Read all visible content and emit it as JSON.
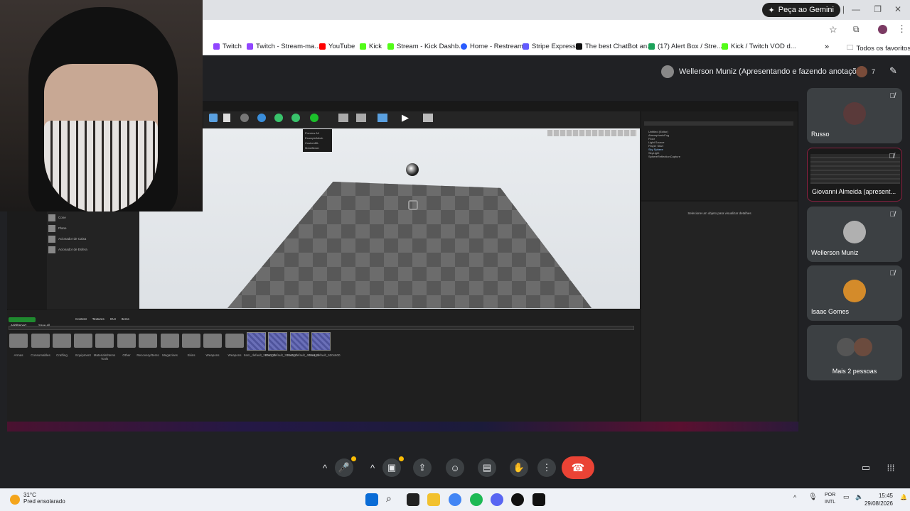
{
  "browser": {
    "gemini_label": "Peça ao Gemini",
    "bookmarks": [
      {
        "label": "Twitch",
        "color": "#9146ff"
      },
      {
        "label": "Twitch - Stream-ma...",
        "color": "#9146ff"
      },
      {
        "label": "YouTube",
        "color": "#ff0000"
      },
      {
        "label": "Kick",
        "color": "#53fc18"
      },
      {
        "label": "Stream - Kick Dashb...",
        "color": "#53fc18"
      },
      {
        "label": "Home - Restream",
        "color": "#2a5cff"
      },
      {
        "label": "Stripe Express",
        "color": "#635bff"
      },
      {
        "label": "The best ChatBot an...",
        "color": "#111111"
      },
      {
        "label": "(17) Alert Box / Stre...",
        "color": "#1ca25a"
      },
      {
        "label": "Kick / Twitch VOD d...",
        "color": "#53fc18"
      }
    ],
    "all_favorites": "Todos os favoritos"
  },
  "meet": {
    "presenter_label": "Wellerson Muniz (Apresentando e fazendo anotações)",
    "participant_count": "7",
    "participants": [
      {
        "name": "Russo",
        "muted": true
      },
      {
        "name": "Giovanni Almeida (apresent...",
        "muted": true
      },
      {
        "name": "Wellerson Muniz",
        "muted": true
      },
      {
        "name": "Isaac Gomes",
        "muted": true
      }
    ],
    "more_people": "Mais 2 pessoas"
  },
  "unreal": {
    "content_path": [
      "Content",
      "Textures",
      "GUI",
      "Items"
    ],
    "save_all": "Save All",
    "add_import": "Add/Import",
    "folders": [
      "Armas",
      "Consumables",
      "Crafting",
      "Equipment",
      "Materials/Items Tools",
      "Other",
      "Recovery/Items",
      "Magazines",
      "Skins",
      "Weapons",
      "Weapons"
    ],
    "textures": [
      "Item_default_200x200",
      "Item_default_300x300",
      "Item_default_400x400",
      "Item_default_600x600"
    ],
    "place_items": [
      "Cone",
      "Plane",
      "Acionador de Caixa",
      "Acionador de Esfera"
    ],
    "outliner_items": [
      "Untitled (Editor)",
      "AtmosphericFog",
      "Floor",
      "Light Source",
      "Player Start",
      "Sky Sphere",
      "SkyLight",
      "SphereReflectionCapture"
    ],
    "details_hint": "Selecione um objeto para visualizar detalhes",
    "show_menu": [
      "Preview All",
      "ExampleMesh",
      "CustomML",
      "Meta/Mesh"
    ]
  },
  "taskbar": {
    "temperature": "31°C",
    "weather": "Pred ensolarado",
    "lang_top": "POR",
    "lang_bottom": "INTL",
    "time": "15:45",
    "date": "29/08/2026"
  }
}
